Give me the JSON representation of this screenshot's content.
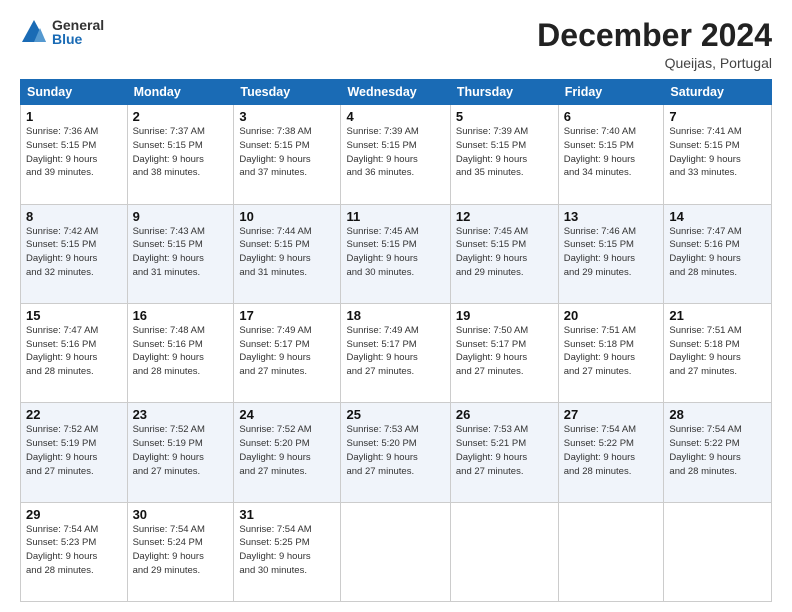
{
  "logo": {
    "general": "General",
    "blue": "Blue"
  },
  "title": "December 2024",
  "location": "Queijas, Portugal",
  "weekdays": [
    "Sunday",
    "Monday",
    "Tuesday",
    "Wednesday",
    "Thursday",
    "Friday",
    "Saturday"
  ],
  "weeks": [
    [
      {
        "day": "1",
        "lines": [
          "Sunrise: 7:36 AM",
          "Sunset: 5:15 PM",
          "Daylight: 9 hours",
          "and 39 minutes."
        ]
      },
      {
        "day": "2",
        "lines": [
          "Sunrise: 7:37 AM",
          "Sunset: 5:15 PM",
          "Daylight: 9 hours",
          "and 38 minutes."
        ]
      },
      {
        "day": "3",
        "lines": [
          "Sunrise: 7:38 AM",
          "Sunset: 5:15 PM",
          "Daylight: 9 hours",
          "and 37 minutes."
        ]
      },
      {
        "day": "4",
        "lines": [
          "Sunrise: 7:39 AM",
          "Sunset: 5:15 PM",
          "Daylight: 9 hours",
          "and 36 minutes."
        ]
      },
      {
        "day": "5",
        "lines": [
          "Sunrise: 7:39 AM",
          "Sunset: 5:15 PM",
          "Daylight: 9 hours",
          "and 35 minutes."
        ]
      },
      {
        "day": "6",
        "lines": [
          "Sunrise: 7:40 AM",
          "Sunset: 5:15 PM",
          "Daylight: 9 hours",
          "and 34 minutes."
        ]
      },
      {
        "day": "7",
        "lines": [
          "Sunrise: 7:41 AM",
          "Sunset: 5:15 PM",
          "Daylight: 9 hours",
          "and 33 minutes."
        ]
      }
    ],
    [
      {
        "day": "8",
        "lines": [
          "Sunrise: 7:42 AM",
          "Sunset: 5:15 PM",
          "Daylight: 9 hours",
          "and 32 minutes."
        ]
      },
      {
        "day": "9",
        "lines": [
          "Sunrise: 7:43 AM",
          "Sunset: 5:15 PM",
          "Daylight: 9 hours",
          "and 31 minutes."
        ]
      },
      {
        "day": "10",
        "lines": [
          "Sunrise: 7:44 AM",
          "Sunset: 5:15 PM",
          "Daylight: 9 hours",
          "and 31 minutes."
        ]
      },
      {
        "day": "11",
        "lines": [
          "Sunrise: 7:45 AM",
          "Sunset: 5:15 PM",
          "Daylight: 9 hours",
          "and 30 minutes."
        ]
      },
      {
        "day": "12",
        "lines": [
          "Sunrise: 7:45 AM",
          "Sunset: 5:15 PM",
          "Daylight: 9 hours",
          "and 29 minutes."
        ]
      },
      {
        "day": "13",
        "lines": [
          "Sunrise: 7:46 AM",
          "Sunset: 5:15 PM",
          "Daylight: 9 hours",
          "and 29 minutes."
        ]
      },
      {
        "day": "14",
        "lines": [
          "Sunrise: 7:47 AM",
          "Sunset: 5:16 PM",
          "Daylight: 9 hours",
          "and 28 minutes."
        ]
      }
    ],
    [
      {
        "day": "15",
        "lines": [
          "Sunrise: 7:47 AM",
          "Sunset: 5:16 PM",
          "Daylight: 9 hours",
          "and 28 minutes."
        ]
      },
      {
        "day": "16",
        "lines": [
          "Sunrise: 7:48 AM",
          "Sunset: 5:16 PM",
          "Daylight: 9 hours",
          "and 28 minutes."
        ]
      },
      {
        "day": "17",
        "lines": [
          "Sunrise: 7:49 AM",
          "Sunset: 5:17 PM",
          "Daylight: 9 hours",
          "and 27 minutes."
        ]
      },
      {
        "day": "18",
        "lines": [
          "Sunrise: 7:49 AM",
          "Sunset: 5:17 PM",
          "Daylight: 9 hours",
          "and 27 minutes."
        ]
      },
      {
        "day": "19",
        "lines": [
          "Sunrise: 7:50 AM",
          "Sunset: 5:17 PM",
          "Daylight: 9 hours",
          "and 27 minutes."
        ]
      },
      {
        "day": "20",
        "lines": [
          "Sunrise: 7:51 AM",
          "Sunset: 5:18 PM",
          "Daylight: 9 hours",
          "and 27 minutes."
        ]
      },
      {
        "day": "21",
        "lines": [
          "Sunrise: 7:51 AM",
          "Sunset: 5:18 PM",
          "Daylight: 9 hours",
          "and 27 minutes."
        ]
      }
    ],
    [
      {
        "day": "22",
        "lines": [
          "Sunrise: 7:52 AM",
          "Sunset: 5:19 PM",
          "Daylight: 9 hours",
          "and 27 minutes."
        ]
      },
      {
        "day": "23",
        "lines": [
          "Sunrise: 7:52 AM",
          "Sunset: 5:19 PM",
          "Daylight: 9 hours",
          "and 27 minutes."
        ]
      },
      {
        "day": "24",
        "lines": [
          "Sunrise: 7:52 AM",
          "Sunset: 5:20 PM",
          "Daylight: 9 hours",
          "and 27 minutes."
        ]
      },
      {
        "day": "25",
        "lines": [
          "Sunrise: 7:53 AM",
          "Sunset: 5:20 PM",
          "Daylight: 9 hours",
          "and 27 minutes."
        ]
      },
      {
        "day": "26",
        "lines": [
          "Sunrise: 7:53 AM",
          "Sunset: 5:21 PM",
          "Daylight: 9 hours",
          "and 27 minutes."
        ]
      },
      {
        "day": "27",
        "lines": [
          "Sunrise: 7:54 AM",
          "Sunset: 5:22 PM",
          "Daylight: 9 hours",
          "and 28 minutes."
        ]
      },
      {
        "day": "28",
        "lines": [
          "Sunrise: 7:54 AM",
          "Sunset: 5:22 PM",
          "Daylight: 9 hours",
          "and 28 minutes."
        ]
      }
    ],
    [
      {
        "day": "29",
        "lines": [
          "Sunrise: 7:54 AM",
          "Sunset: 5:23 PM",
          "Daylight: 9 hours",
          "and 28 minutes."
        ]
      },
      {
        "day": "30",
        "lines": [
          "Sunrise: 7:54 AM",
          "Sunset: 5:24 PM",
          "Daylight: 9 hours",
          "and 29 minutes."
        ]
      },
      {
        "day": "31",
        "lines": [
          "Sunrise: 7:54 AM",
          "Sunset: 5:25 PM",
          "Daylight: 9 hours",
          "and 30 minutes."
        ]
      },
      null,
      null,
      null,
      null
    ]
  ]
}
